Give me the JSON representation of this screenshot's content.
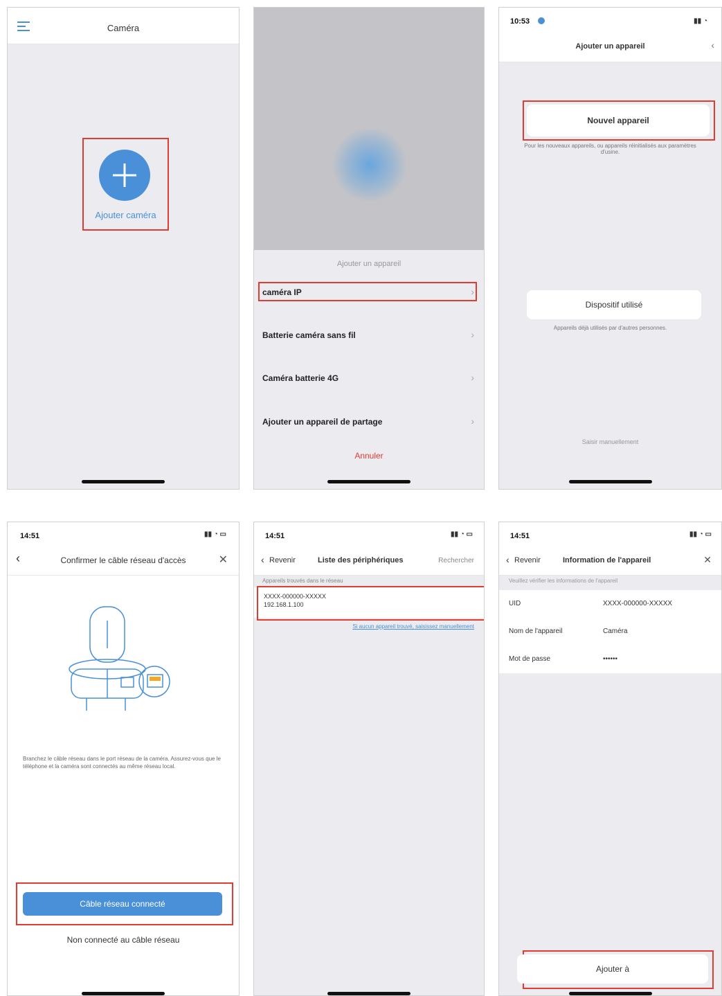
{
  "screen1": {
    "title": "Caméra",
    "add_label": "Ajouter caméra",
    "icons": {
      "menu": "menu-icon",
      "add": "plus-icon"
    }
  },
  "screen2": {
    "sheet_title": "Ajouter un appareil",
    "items": [
      "caméra IP",
      "Batterie caméra sans fil",
      "Caméra batterie 4G",
      "Ajouter un appareil de partage"
    ],
    "cancel": "Annuler"
  },
  "screen3": {
    "time": "10:53",
    "title": "Ajouter un appareil",
    "new_device": "Nouvel appareil",
    "new_desc": "Pour les nouveaux appareils, ou appareils réinitialisés aux paramètres d'usine.",
    "used_device": "Dispositif utilisé",
    "used_desc": "Appareils déjà utilisés par d'autres personnes.",
    "footer": "Saisir manuellement"
  },
  "screen4": {
    "time": "14:51",
    "title": "Confirmer le câble réseau d'accès",
    "desc": "Branchez le câble réseau dans le port réseau de la caméra. Assurez-vous que le téléphone et la caméra sont connectés au même réseau local.",
    "primary": "Câble réseau connecté",
    "secondary": "Non connecté au câble réseau"
  },
  "screen5": {
    "time": "14:51",
    "back": "Revenir",
    "title": "Liste des périphériques",
    "refresh": "Rechercher",
    "section": "Appareils trouvés dans le réseau",
    "device_id": "XXXX-000000-XXXXX",
    "device_ip": "192.168.1.100",
    "link": "Si aucun appareil trouvé, saisissez manuellement"
  },
  "screen6": {
    "time": "14:51",
    "back": "Revenir",
    "title": "Information de l'appareil",
    "subtitle": "Veuillez vérifier les informations de l'appareil",
    "rows": [
      {
        "label": "UID",
        "value": "XXXX-000000-XXXXX"
      },
      {
        "label": "Nom de l'appareil",
        "value": "Caméra"
      },
      {
        "label": "Mot de passe",
        "value": "••••••"
      }
    ],
    "add_button": "Ajouter à"
  }
}
